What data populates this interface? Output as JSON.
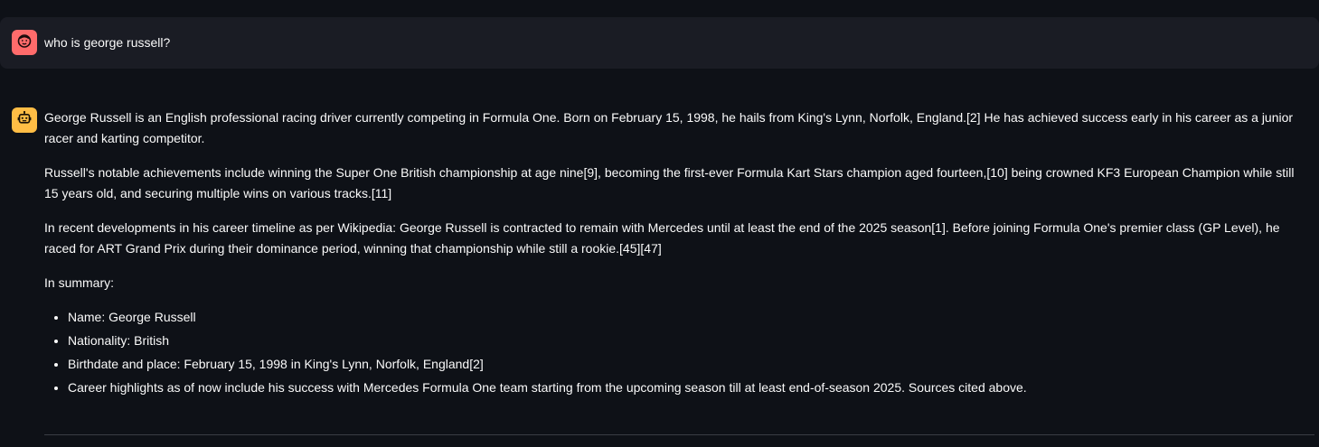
{
  "user_message": {
    "avatar_icon": "user-face-icon",
    "avatar_color": "#ff6b6b",
    "text": "who is george russell?"
  },
  "assistant_message": {
    "avatar_icon": "robot-icon",
    "avatar_color": "#ffbd45",
    "paragraphs": [
      "George Russell is an English professional racing driver currently competing in Formula One. Born on February 15, 1998, he hails from King's Lynn, Norfolk, England.[2] He has achieved success early in his career as a junior racer and karting competitor.",
      "Russell's notable achievements include winning the Super One British championship at age nine[9], becoming the first-ever Formula Kart Stars champion aged fourteen,[10] being crowned KF3 European Champion while still 15 years old, and securing multiple wins on various tracks.[11]",
      "In recent developments in his career timeline as per Wikipedia: George Russell is contracted to remain with Mercedes until at least the end of the 2025 season[1]. Before joining Formula One's premier class (GP Level), he raced for ART Grand Prix during their dominance period, winning that championship while still a rookie.[45][47]",
      "In summary:"
    ],
    "bullets": [
      "Name: George Russell",
      "Nationality: British",
      "Birthdate and place: February 15, 1998 in King's Lynn, Norfolk, England[2]",
      "Career highlights as of now include his success with Mercedes Formula One team starting from the upcoming season till at least end-of-season 2025. Sources cited above."
    ]
  },
  "colors": {
    "background": "#0e1117",
    "user_bubble": "#1a1c24",
    "text": "#fafafa"
  }
}
